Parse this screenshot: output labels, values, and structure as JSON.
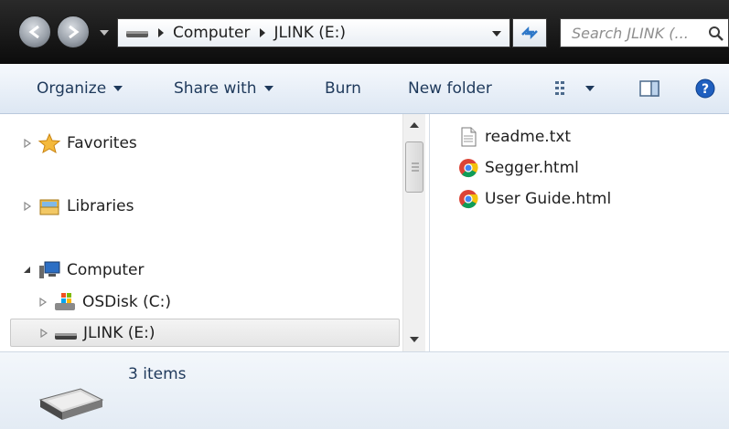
{
  "address": {
    "crumbs": [
      "Computer",
      "JLINK (E:)"
    ],
    "search_placeholder": "Search JLINK (... "
  },
  "toolbar": {
    "organize": "Organize",
    "share_with": "Share with",
    "burn": "Burn",
    "new_folder": "New folder"
  },
  "nav": {
    "favorites": "Favorites",
    "libraries": "Libraries",
    "computer": "Computer",
    "osdisk": "OSDisk (C:)",
    "jlink": "JLINK (E:)"
  },
  "files": [
    {
      "name": "readme.txt",
      "icon": "text-file-icon"
    },
    {
      "name": "Segger.html",
      "icon": "chrome-icon"
    },
    {
      "name": "User Guide.html",
      "icon": "chrome-icon"
    }
  ],
  "details": {
    "count": "3 items"
  },
  "colors": {
    "titlebar": "#0c0c0c",
    "toolbar_text": "#1e395b",
    "help_blue": "#1f5fbf"
  }
}
